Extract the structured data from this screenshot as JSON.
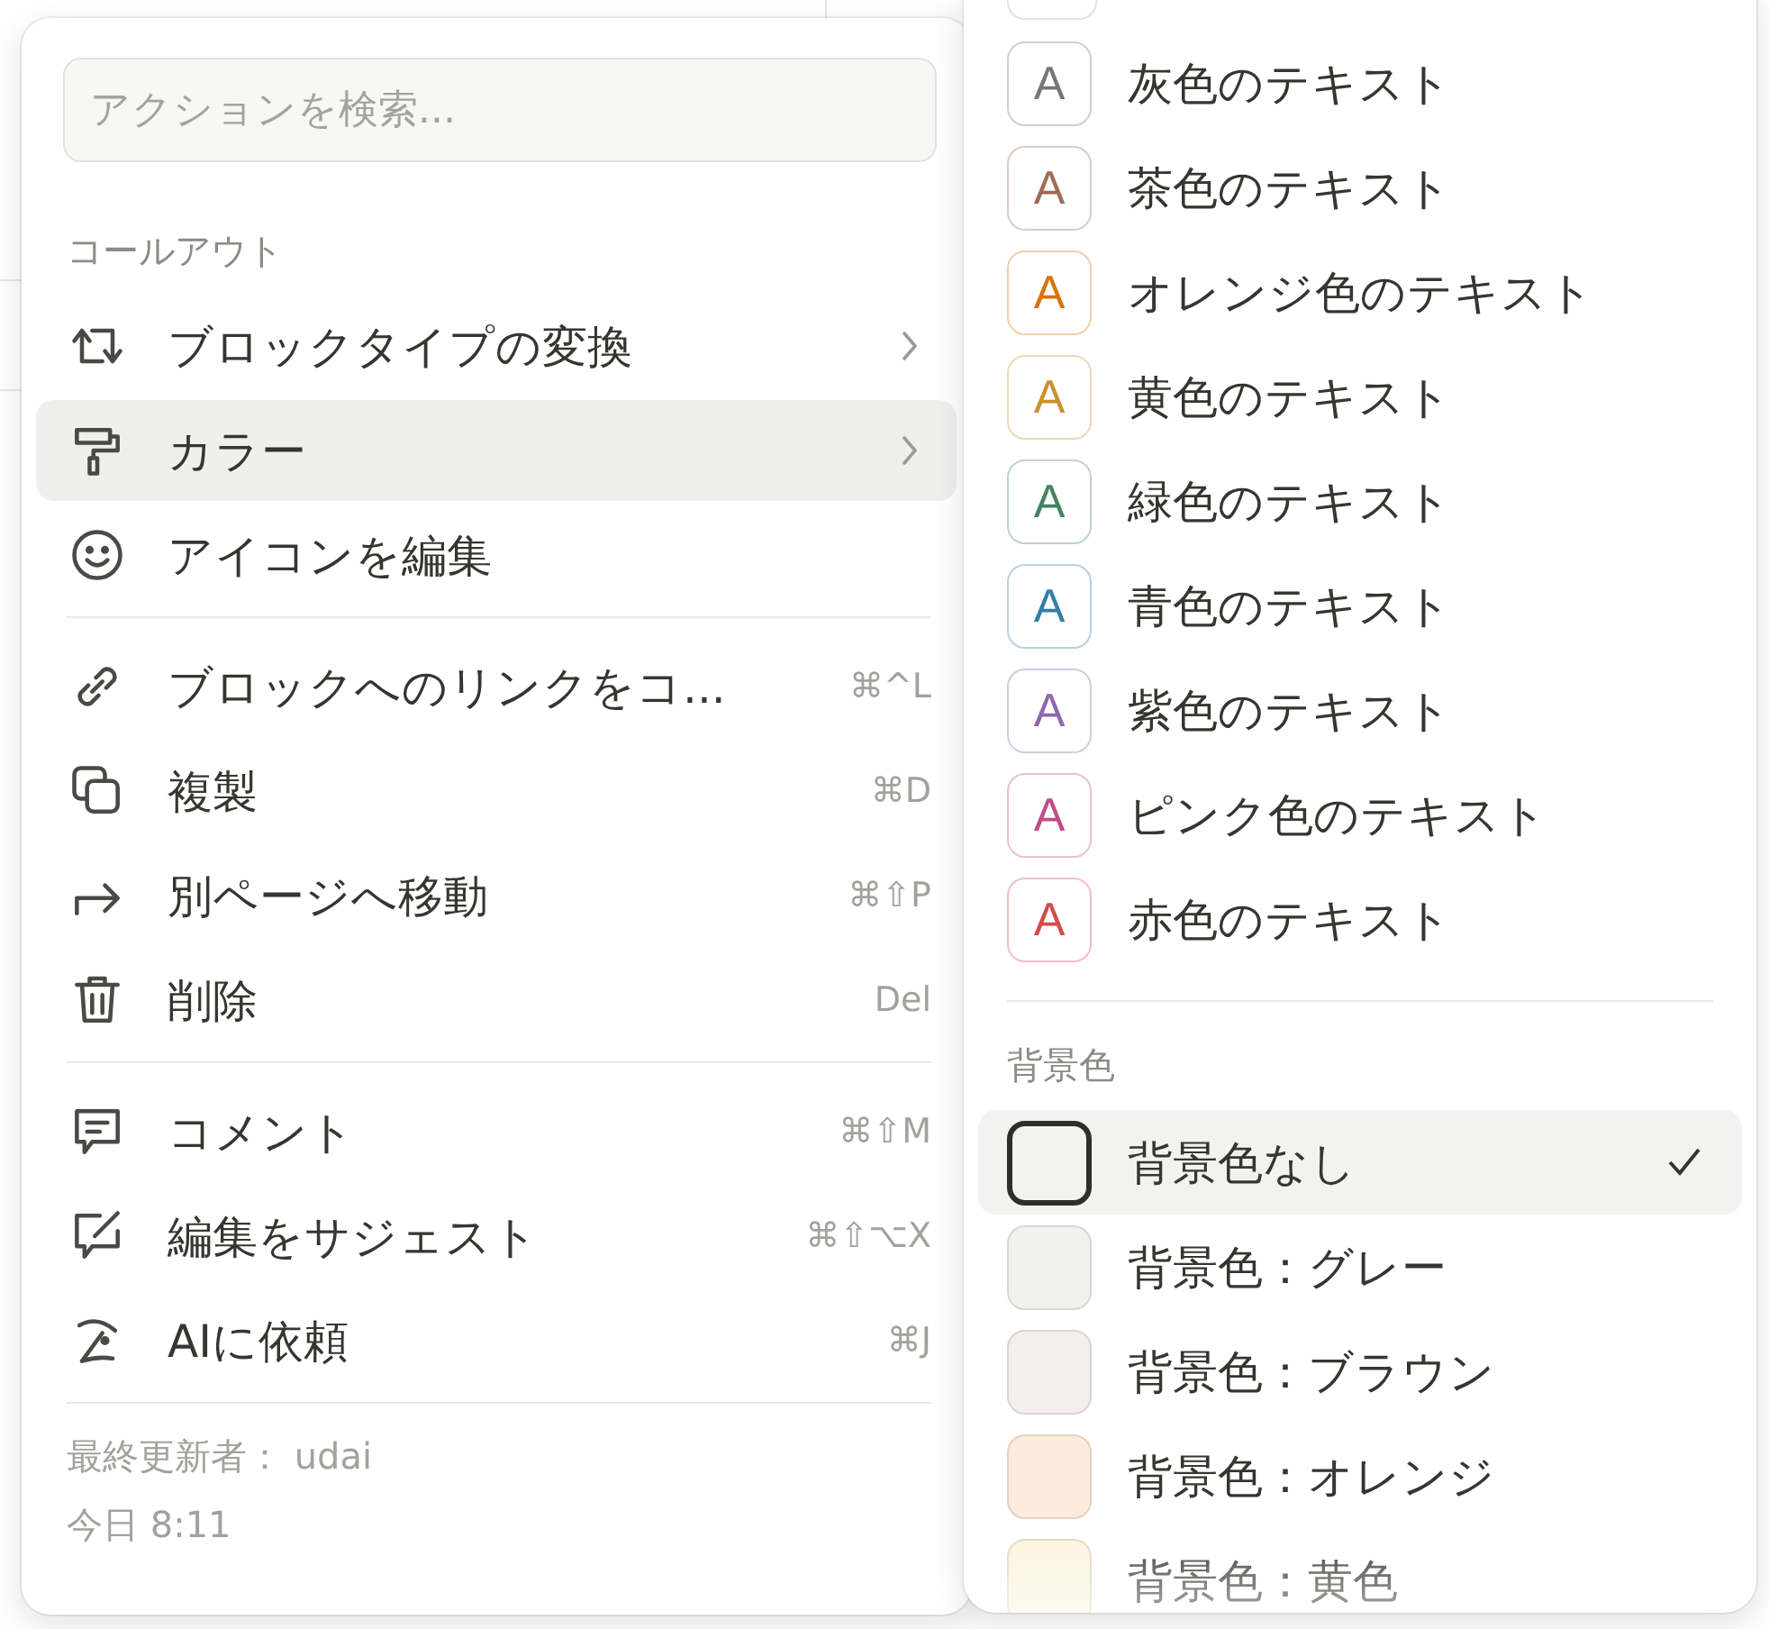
{
  "main_menu": {
    "search": {
      "placeholder": "アクションを検索..."
    },
    "section_title": "コールアウト",
    "groups": [
      [
        {
          "kind": "convert",
          "label": "ブロックタイプの変換",
          "submenu": true,
          "selected": false
        },
        {
          "kind": "roller",
          "label": "カラー",
          "submenu": true,
          "selected": true
        },
        {
          "kind": "smiley",
          "label": "アイコンを編集",
          "submenu": false,
          "selected": false
        }
      ],
      [
        {
          "kind": "link",
          "label": "ブロックへのリンクをコ...",
          "shortcut": "⌘^L",
          "submenu": false,
          "selected": false
        },
        {
          "kind": "duplicate",
          "label": "複製",
          "shortcut": "⌘D",
          "submenu": false,
          "selected": false
        },
        {
          "kind": "move",
          "label": "別ページへ移動",
          "shortcut": "⌘⇧P",
          "submenu": false,
          "selected": false
        },
        {
          "kind": "trash",
          "label": "削除",
          "shortcut": "Del",
          "submenu": false,
          "selected": false
        }
      ],
      [
        {
          "kind": "comment",
          "label": "コメント",
          "shortcut": "⌘⇧M",
          "submenu": false,
          "selected": false
        },
        {
          "kind": "suggest",
          "label": "編集をサジェスト",
          "shortcut": "⌘⇧⌥X",
          "submenu": false,
          "selected": false
        },
        {
          "kind": "ai",
          "label": "AIに依頼",
          "shortcut": "⌘J",
          "submenu": false,
          "selected": false
        }
      ]
    ],
    "footer": {
      "edited_by": "最終更新者： udai",
      "edited_at": "今日 8:11"
    }
  },
  "color_menu": {
    "text_colors": [
      {
        "glyph": "A",
        "label": "灰色のテキスト",
        "color": "#787774"
      },
      {
        "glyph": "A",
        "label": "茶色のテキスト",
        "color": "#9f6b53"
      },
      {
        "glyph": "A",
        "label": "オレンジ色のテキスト",
        "color": "#d9730d"
      },
      {
        "glyph": "A",
        "label": "黄色のテキスト",
        "color": "#cb912f"
      },
      {
        "glyph": "A",
        "label": "緑色のテキスト",
        "color": "#448361"
      },
      {
        "glyph": "A",
        "label": "青色のテキスト",
        "color": "#337ea9"
      },
      {
        "glyph": "A",
        "label": "紫色のテキスト",
        "color": "#9065b0"
      },
      {
        "glyph": "A",
        "label": "ピンク色のテキスト",
        "color": "#c14c8a"
      },
      {
        "glyph": "A",
        "label": "赤色のテキスト",
        "color": "#d44c47"
      }
    ],
    "background_title": "背景色",
    "background_colors": [
      {
        "label": "背景色なし",
        "selected": true
      },
      {
        "label": "背景色：グレー",
        "color": "#f1f1ef",
        "selected": false
      },
      {
        "label": "背景色：ブラウン",
        "color": "#f4eeee",
        "selected": false
      },
      {
        "label": "背景色：オレンジ",
        "color": "#fbecdd",
        "selected": false
      },
      {
        "label": "背景色：黄色",
        "color": "#fbf3db",
        "selected": false
      }
    ]
  }
}
